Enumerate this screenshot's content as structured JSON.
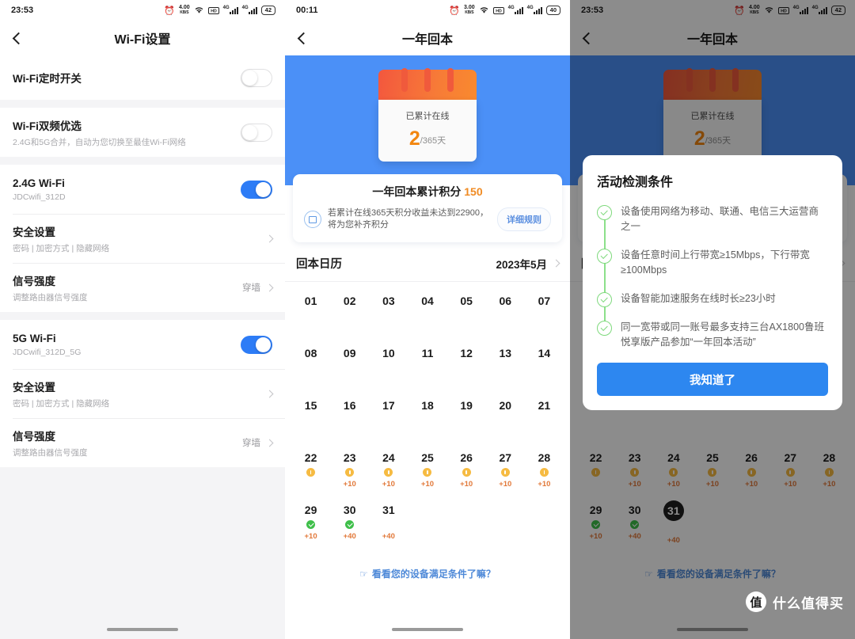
{
  "left_panel": {
    "status": {
      "time": "23:53",
      "net_speed": "4.00",
      "net_unit": "KB/S",
      "battery": "42",
      "sim1": "4G",
      "sim2": "4G"
    },
    "nav": {
      "title": "Wi-Fi设置",
      "back_icon": "chevron-left-icon"
    },
    "rows": [
      {
        "title": "Wi-Fi定时开关",
        "sub": "",
        "control": "toggle",
        "state": "off",
        "value": ""
      },
      {
        "title": "Wi-Fi双频优选",
        "sub": "2.4G和5G合并，自动为您切换至最佳Wi-Fi网络",
        "control": "toggle",
        "state": "off",
        "value": ""
      },
      {
        "title": "2.4G Wi-Fi",
        "sub": "JDCwifi_312D",
        "control": "toggle",
        "state": "on",
        "value": ""
      },
      {
        "title": "安全设置",
        "sub": "密码 | 加密方式 | 隐藏网络",
        "control": "chevron",
        "state": "",
        "value": ""
      },
      {
        "title": "信号强度",
        "sub": "调整路由器信号强度",
        "control": "chevron",
        "state": "",
        "value": "穿墙"
      },
      {
        "title": "5G Wi-Fi",
        "sub": "JDCwifi_312D_5G",
        "control": "toggle",
        "state": "on",
        "value": ""
      },
      {
        "title": "安全设置",
        "sub": "密码 | 加密方式 | 隐藏网络",
        "control": "chevron",
        "state": "",
        "value": ""
      },
      {
        "title": "信号强度",
        "sub": "调整路由器信号强度",
        "control": "chevron",
        "state": "",
        "value": "穿墙"
      }
    ]
  },
  "mid_panel": {
    "status": {
      "time": "00:11",
      "net_speed": "3.00",
      "net_unit": "KB/S",
      "battery": "40",
      "sim1": "4G",
      "sim2": "4G"
    },
    "nav": {
      "title": "一年回本",
      "back_icon": "chevron-left-icon"
    },
    "hero": {
      "calendar_label": "已累计在线",
      "days_done": "2",
      "days_total": "/365天"
    },
    "points_card": {
      "title_text": "一年回本累计积分",
      "points": "150",
      "desc": "若累计在线365天积分收益未达到22900，将为您补齐积分",
      "rules_button": "详细规则",
      "icon": "coin-refresh-icon"
    },
    "calendar_section": {
      "title": "回本日历",
      "month": "2023年5月",
      "chevron": "chevron-right-icon",
      "days": [
        {
          "num": "01",
          "badge": "",
          "pts": ""
        },
        {
          "num": "02",
          "badge": "",
          "pts": ""
        },
        {
          "num": "03",
          "badge": "",
          "pts": ""
        },
        {
          "num": "04",
          "badge": "",
          "pts": ""
        },
        {
          "num": "05",
          "badge": "",
          "pts": ""
        },
        {
          "num": "06",
          "badge": "",
          "pts": ""
        },
        {
          "num": "07",
          "badge": "",
          "pts": ""
        },
        {
          "num": "08",
          "badge": "",
          "pts": ""
        },
        {
          "num": "09",
          "badge": "",
          "pts": ""
        },
        {
          "num": "10",
          "badge": "",
          "pts": ""
        },
        {
          "num": "11",
          "badge": "",
          "pts": ""
        },
        {
          "num": "12",
          "badge": "",
          "pts": ""
        },
        {
          "num": "13",
          "badge": "",
          "pts": ""
        },
        {
          "num": "14",
          "badge": "",
          "pts": ""
        },
        {
          "num": "15",
          "badge": "",
          "pts": ""
        },
        {
          "num": "16",
          "badge": "",
          "pts": ""
        },
        {
          "num": "17",
          "badge": "",
          "pts": ""
        },
        {
          "num": "18",
          "badge": "",
          "pts": ""
        },
        {
          "num": "19",
          "badge": "",
          "pts": ""
        },
        {
          "num": "20",
          "badge": "",
          "pts": ""
        },
        {
          "num": "21",
          "badge": "",
          "pts": ""
        },
        {
          "num": "22",
          "badge": "warn",
          "pts": ""
        },
        {
          "num": "23",
          "badge": "warn",
          "pts": "+10"
        },
        {
          "num": "24",
          "badge": "warn",
          "pts": "+10"
        },
        {
          "num": "25",
          "badge": "warn",
          "pts": "+10"
        },
        {
          "num": "26",
          "badge": "warn",
          "pts": "+10"
        },
        {
          "num": "27",
          "badge": "warn",
          "pts": "+10"
        },
        {
          "num": "28",
          "badge": "warn",
          "pts": "+10"
        },
        {
          "num": "29",
          "badge": "ok",
          "pts": "+10"
        },
        {
          "num": "30",
          "badge": "ok",
          "pts": "+40"
        },
        {
          "num": "31",
          "badge": "",
          "pts": "+40"
        }
      ]
    },
    "foot_link": {
      "hand_icon": "pointing-hand-icon",
      "text": "看看您的设备满足条件了嘛？"
    }
  },
  "right_panel": {
    "status": {
      "time": "23:53",
      "net_speed": "4.00",
      "net_unit": "KB/S",
      "battery": "42",
      "sim1": "4G",
      "sim2": "4G"
    },
    "nav": {
      "title": "一年回本",
      "back_icon": "chevron-left-icon"
    },
    "hero": {
      "calendar_label": "已累计在线",
      "days_done": "2",
      "days_total": "/365天"
    },
    "selected_day": "31",
    "modal": {
      "title": "活动检测条件",
      "steps": [
        "设备使用网络为移动、联通、电信三大运营商之一",
        "设备任意时间上行带宽≥15Mbps，下行带宽≥100Mbps",
        "设备智能加速服务在线时长≥23小时",
        "同一宽带或同一账号最多支持三台AX1800鲁班悦享版产品参加“一年回本活动”"
      ],
      "confirm_button": "我知道了"
    },
    "foot_link": {
      "hand_icon": "pointing-hand-icon",
      "text": "看看您的设备满足条件了嘛？"
    },
    "watermark": {
      "logo": "值",
      "text": "什么值得买"
    }
  },
  "colors": {
    "accent_blue": "#4b90f7",
    "toggle_on": "#2d7cf6",
    "orange": "#f2860f",
    "points_orange": "#e2793a",
    "green": "#3fbf4a",
    "warn_yellow": "#f6bb42",
    "link_blue": "#4e89d8"
  }
}
